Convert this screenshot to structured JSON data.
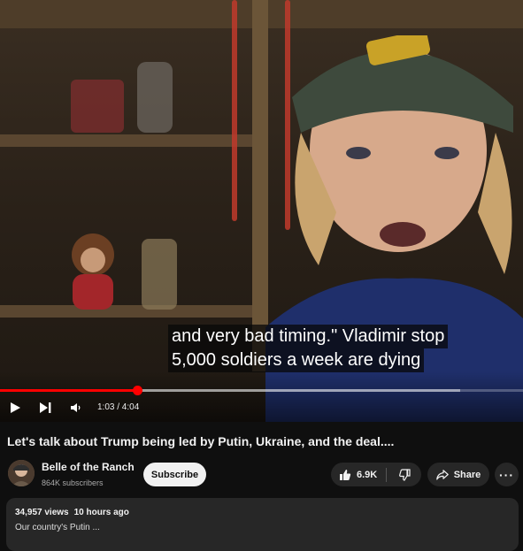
{
  "player": {
    "captions": [
      "and very bad timing.\" Vladimir stop",
      "5,000 soldiers a week are dying"
    ],
    "progress_fraction": 0.263,
    "buffered_fraction": 0.88,
    "time_display": "1:03 / 4:04",
    "icons": {
      "play": "play-icon",
      "next": "next-icon",
      "volume": "volume-icon"
    },
    "colors": {
      "played": "#ff0000"
    }
  },
  "video": {
    "title": "Let's talk about Trump being led by Putin, Ukraine, and the deal....",
    "views": "34,957 views",
    "age": "10 hours ago",
    "description_peek": "Our country's   Putin    ..."
  },
  "channel": {
    "name": "Belle of the Ranch",
    "subscribers": "864K subscribers",
    "subscribe_label": "Subscribe"
  },
  "actions": {
    "like_count": "6.9K",
    "share_label": "Share",
    "more_label": "···"
  },
  "theme": {
    "background": "#0f0f0f",
    "chip": "#272727",
    "text": "#f1f1f1"
  }
}
